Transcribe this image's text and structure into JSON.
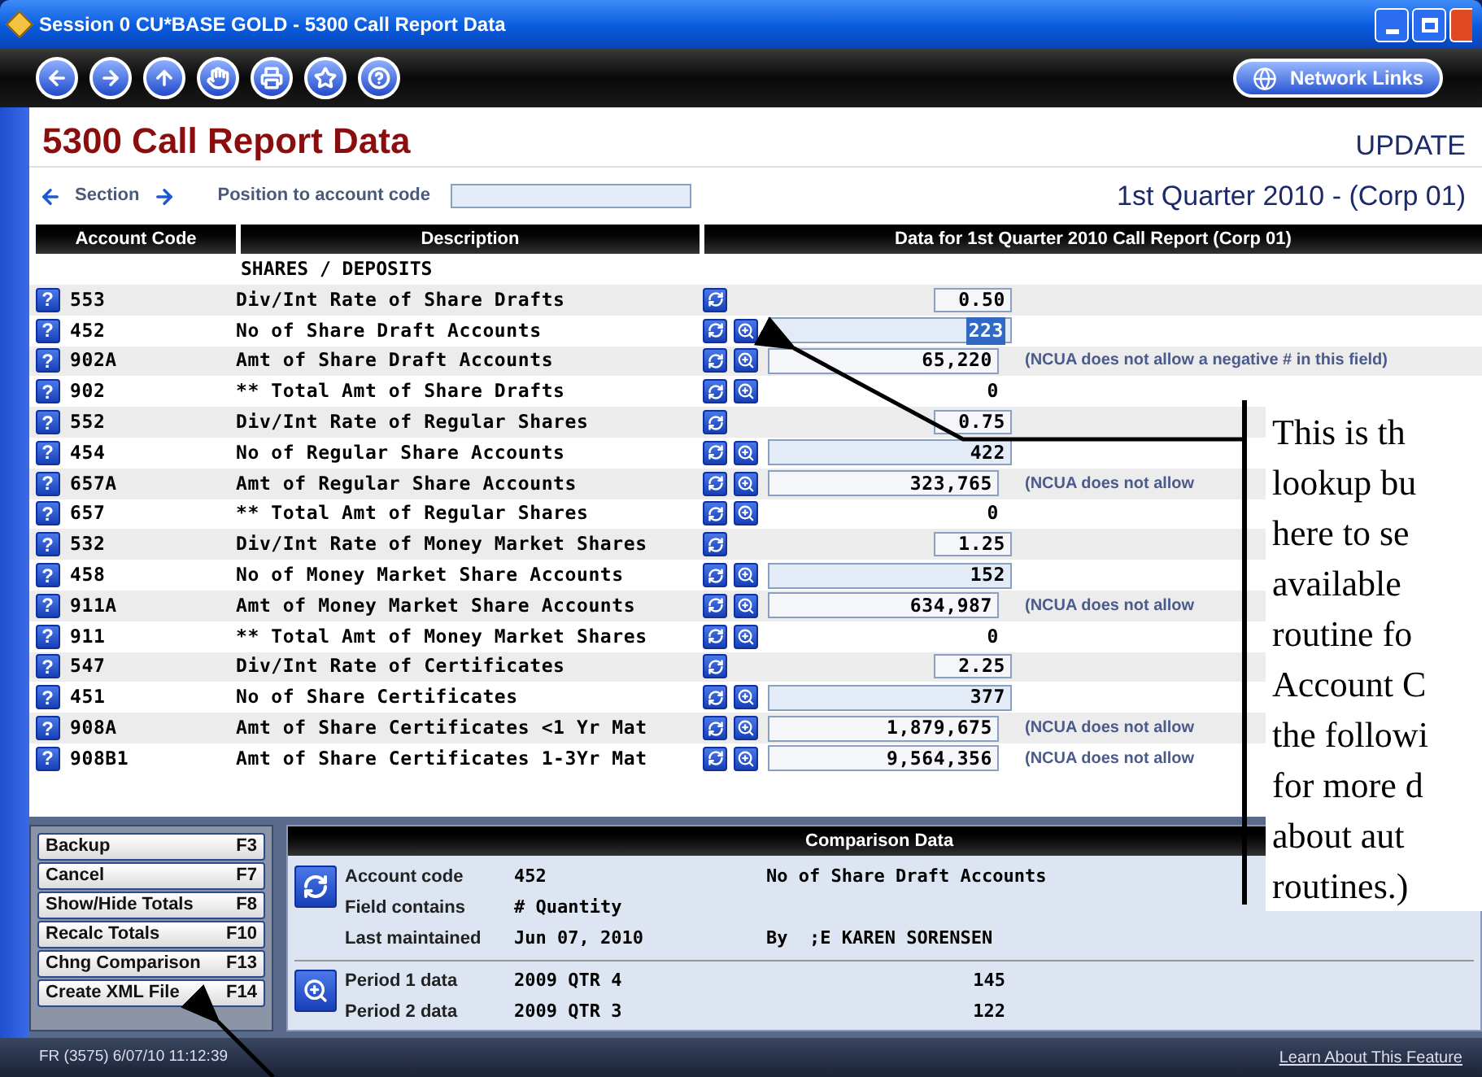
{
  "window": {
    "title": "Session 0 CU*BASE GOLD - 5300 Call Report Data"
  },
  "toolbar": {
    "network_button": "Network Links"
  },
  "page": {
    "title": "5300 Call Report Data",
    "mode": "UPDATE",
    "section_label": "Section",
    "position_label": "Position to account code",
    "period": "1st Quarter 2010 - (Corp 01)"
  },
  "table": {
    "columns": [
      "Account Code",
      "Description",
      "Data for 1st Quarter 2010 Call Report (Corp 01)"
    ],
    "group_label": "SHARES / DEPOSITS",
    "help_glyph": "?",
    "rows": [
      {
        "code": "553",
        "description": "Div/Int Rate of Share Drafts",
        "kind": "rate",
        "value": "0.50",
        "lookup": false,
        "selected": false
      },
      {
        "code": "452",
        "description": "No of Share Draft Accounts",
        "kind": "count",
        "value": "223",
        "lookup": true,
        "selected": true
      },
      {
        "code": "902A",
        "description": "Amt of Share Draft Accounts",
        "kind": "amount",
        "value": "65,220",
        "lookup": true,
        "selected": false,
        "note": "(NCUA does not allow a negative # in this field)"
      },
      {
        "code": "902",
        "description": "** Total Amt of Share Drafts",
        "kind": "total",
        "value": "0",
        "lookup": true,
        "selected": false
      },
      {
        "code": "552",
        "description": "Div/Int Rate of Regular Shares",
        "kind": "rate",
        "value": "0.75",
        "lookup": false,
        "selected": false
      },
      {
        "code": "454",
        "description": "No of Regular Share Accounts",
        "kind": "count",
        "value": "422",
        "lookup": true,
        "selected": false
      },
      {
        "code": "657A",
        "description": "Amt of Regular Share Accounts",
        "kind": "amount",
        "value": "323,765",
        "lookup": true,
        "selected": false,
        "note": "(NCUA does not allow"
      },
      {
        "code": "657",
        "description": "** Total Amt of Regular Shares",
        "kind": "total",
        "value": "0",
        "lookup": true,
        "selected": false
      },
      {
        "code": "532",
        "description": "Div/Int Rate of Money Market Shares",
        "kind": "rate",
        "value": "1.25",
        "lookup": false,
        "selected": false
      },
      {
        "code": "458",
        "description": "No of Money Market Share Accounts",
        "kind": "count",
        "value": "152",
        "lookup": true,
        "selected": false
      },
      {
        "code": "911A",
        "description": "Amt of Money Market Share Accounts",
        "kind": "amount",
        "value": "634,987",
        "lookup": true,
        "selected": false,
        "note": "(NCUA does not allow"
      },
      {
        "code": "911",
        "description": "** Total Amt of Money Market Shares",
        "kind": "total",
        "value": "0",
        "lookup": true,
        "selected": false
      },
      {
        "code": "547",
        "description": "Div/Int Rate of Certificates",
        "kind": "rate",
        "value": "2.25",
        "lookup": false,
        "selected": false
      },
      {
        "code": "451",
        "description": "No of Share Certificates",
        "kind": "count",
        "value": "377",
        "lookup": true,
        "selected": false
      },
      {
        "code": "908A",
        "description": "Amt of Share Certificates <1 Yr Mat",
        "kind": "amount",
        "value": "1,879,675",
        "lookup": true,
        "selected": false,
        "note": "(NCUA does not allow"
      },
      {
        "code": "908B1",
        "description": "Amt of Share Certificates 1-3Yr Mat",
        "kind": "amount",
        "value": "9,564,356",
        "lookup": true,
        "selected": false,
        "note": "(NCUA does not allow"
      }
    ]
  },
  "function_keys": [
    {
      "label": "Backup",
      "key": "F3"
    },
    {
      "label": "Cancel",
      "key": "F7"
    },
    {
      "label": "Show/Hide Totals",
      "key": "F8"
    },
    {
      "label": "Recalc Totals",
      "key": "F10"
    },
    {
      "label": "Chng Comparison",
      "key": "F13"
    },
    {
      "label": "Create XML File",
      "key": "F14"
    }
  ],
  "comparison": {
    "title": "Comparison Data",
    "fields": [
      {
        "label": "Account code",
        "value": "452",
        "extra": "No of Share Draft Accounts"
      },
      {
        "label": "Field contains",
        "value": "# Quantity"
      },
      {
        "label": "Last maintained",
        "value": "Jun 07, 2010",
        "extra": "By  ;E KAREN SORENSEN"
      }
    ],
    "periods": [
      {
        "label": "Period 1 data",
        "value": "2009 QTR 4",
        "amount": "145"
      },
      {
        "label": "Period 2 data",
        "value": "2009 QTR 3",
        "amount": "122"
      }
    ]
  },
  "status_bar": {
    "text": "FR (3575) 6/07/10 11:12:39",
    "link": "Learn About This Feature"
  },
  "callout": {
    "lines": [
      "This is th",
      "lookup bu",
      "here to se",
      "available",
      "routine fo",
      "Account C",
      "the followi",
      "for more d",
      "about aut",
      "routines.)"
    ]
  }
}
